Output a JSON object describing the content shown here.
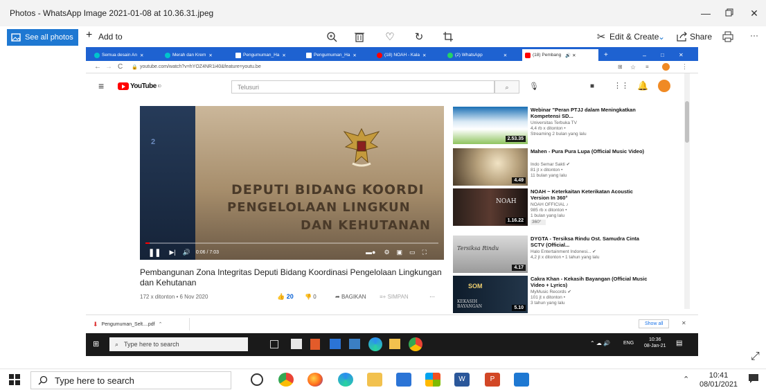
{
  "window": {
    "title": "Photos - WhatsApp Image 2021-01-08 at 10.36.31.jpeg"
  },
  "photos_toolbar": {
    "see_all": "See all photos",
    "add_to": "Add to",
    "edit_create": "Edit & Create",
    "share": "Share",
    "more": "···"
  },
  "browser": {
    "tabs": [
      {
        "label": "Semua desain An",
        "color": "#00c4cc"
      },
      {
        "label": "Merah dan Krem",
        "color": "#00c4cc"
      },
      {
        "label": "Pengumuman_Ha",
        "color": "#ffffff"
      },
      {
        "label": "Pengumuman_Ha",
        "color": "#ffffff"
      },
      {
        "label": "(18) NOAH - Kala",
        "color": "#ff0000"
      },
      {
        "label": "(2) WhatsApp",
        "color": "#25d366"
      },
      {
        "label": "(18) Pembang",
        "color": "#ff0000"
      }
    ],
    "url": "youtube.com/watch?v=hYOZ4NR1i40&feature=youtu.be"
  },
  "youtube": {
    "logo": "YouTube",
    "logo_suffix": "ID",
    "search_placeholder": "Telusuri",
    "video": {
      "plaque_line1": "DEPUTI BIDANG KOORDI",
      "plaque_line2": "PENGELOLAAN LINGKUN",
      "plaque_line3": "DAN KEHUTANAN",
      "floor_label": "2",
      "time": "0:06 / 7:03",
      "progress": 0.014,
      "title": "Pembangunan Zona Integritas Deputi Bidang Koordinasi Pengelolaan Lingkungan dan Kehutanan",
      "views_date": "172 x ditonton • 6 Nov 2020",
      "likes": "20",
      "dislikes": "0",
      "share": "BAGIKAN",
      "save": "SIMPAN",
      "more": "···"
    },
    "recommendations": [
      {
        "title": "Webinar \"Peran PTJJ dalam Meningkatkan Kompetensi SD...",
        "channel": "Universitas Terbuka TV",
        "views": "4,4 rb x ditonton •",
        "age": "Streaming 2 bulan yang lalu",
        "extra": "",
        "duration": "2.53.35"
      },
      {
        "title": "Mahen - Pura Pura Lupa (Official Music Video)",
        "channel": "Indo Semar Sakti ✔",
        "views": "81 jt x ditonton •",
        "age": "11 bulan yang lalu",
        "extra": "",
        "duration": "4.49"
      },
      {
        "title": "NOAH ~ Keterkaitan Keterikatan Acoustic Version In 360°",
        "channel": "NOAH OFFICIAL ♪",
        "views": "985 rb x ditonton •",
        "age": "1 bulan yang lalu",
        "extra": "360°",
        "duration": "1.16.22"
      },
      {
        "title": "DYGTA - Tersiksa Rindu Ost. Samudra Cinta SCTV (Official...",
        "channel": "Halo Entertainment Indonesi... ✔",
        "views": "4,2 jt x ditonton • 1 tahun yang lalu",
        "age": "",
        "extra": "",
        "duration": "4.17"
      },
      {
        "title": "Cakra Khan - Kekasih Bayangan (Official Music Video + Lyrics)",
        "channel": "MyMusic Records ✔",
        "views": "101 jt x ditonton •",
        "age": "3 tahun yang lalu",
        "extra": "",
        "duration": "5.10"
      }
    ],
    "rec_thumb_text": {
      "t3": "NOAH",
      "t4": "Tersiksa Rindu",
      "t5a": "SOM",
      "t5b": "KEKASIH BAYANGAN"
    }
  },
  "download_bar": {
    "file": "Pengumuman_Selt....pdf",
    "show_all": "Show all"
  },
  "inner_taskbar": {
    "search": "Type here to search",
    "lang": "ENG",
    "time": "10:36",
    "date": "08-Jan-21"
  },
  "taskbar": {
    "search": "Type here to search",
    "time": "10:41",
    "date": "08/01/2021"
  },
  "colors": {
    "accent": "#1e78d2",
    "chrome_tabs": "#1e62d1",
    "youtube_red": "#ff0000"
  }
}
